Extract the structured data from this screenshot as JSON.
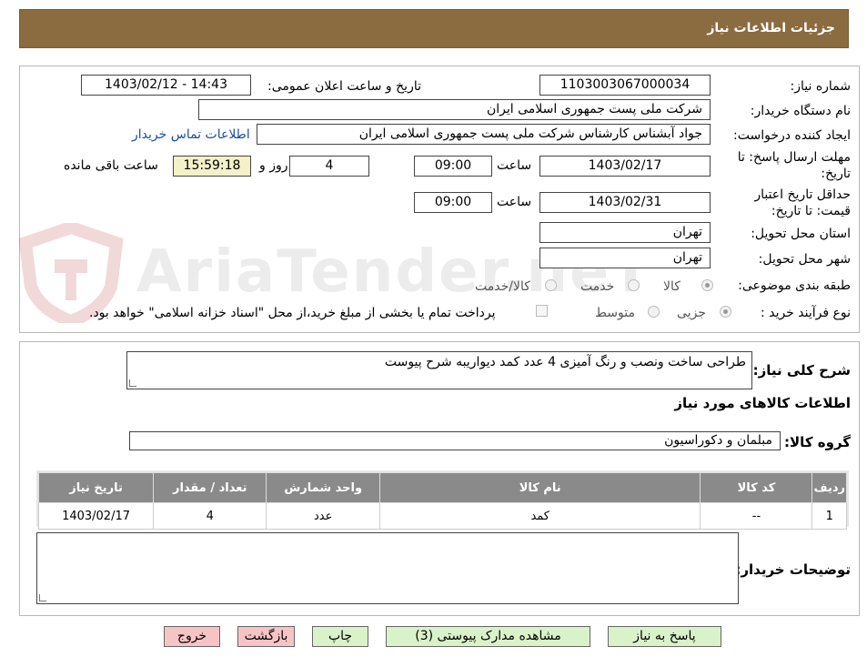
{
  "header": {
    "title": "جزئیات اطلاعات نیاز"
  },
  "watermark": {
    "text": "AriaTender.neT"
  },
  "form": {
    "need_number_label": "شماره نیاز:",
    "need_number": "1103003067000034",
    "announce_label": "تاریخ و ساعت اعلان عمومی:",
    "announce_value": "1403/02/12 - 14:43",
    "buyer_label": "نام دستگاه خریدار:",
    "buyer_value": "شرکت ملی پست جمهوری اسلامی ایران",
    "creator_label": "ایجاد کننده درخواست:",
    "creator_value": "جواد آبشناس کارشناس شرکت ملی پست جمهوری اسلامی ایران",
    "contact_link": "اطلاعات تماس خریدار",
    "deadline_label_1": "مهلت ارسال پاسخ: تا",
    "deadline_label_2": "تاریخ:",
    "deadline_date": "1403/02/17",
    "time_label": "ساعت",
    "deadline_time": "09:00",
    "days_value": "4",
    "days_label": "روز و",
    "remaining_time": "15:59:18",
    "remaining_label": "ساعت باقی مانده",
    "validity_label_1": "حداقل تاریخ اعتبار",
    "validity_label_2": "قیمت: تا تاریخ:",
    "validity_date": "1403/02/31",
    "validity_time": "09:00",
    "province_label": "استان محل تحویل:",
    "province_value": "تهران",
    "city_label": "شهر محل تحویل:",
    "city_value": "تهران",
    "category_label": "طبقه بندی موضوعی:",
    "category_options": [
      "کالا",
      "خدمت",
      "کالا/خدمت"
    ],
    "process_label": "نوع فرآیند خرید :",
    "process_options": [
      "جزیی",
      "متوسط"
    ],
    "payment_note": "پرداخت تمام یا بخشی از مبلغ خرید،از محل \"اسناد خزانه اسلامی\" خواهد بود."
  },
  "details": {
    "summary_label": "شرح کلی نیاز:",
    "summary_value": "طراحی ساخت ونصب و رنگ آمیزی 4 عدد کمد دیواریبه شرح پیوست",
    "goods_info_title": "اطلاعات کالاهای مورد نیاز",
    "group_label": "گروه کالا:",
    "group_value": "مبلمان و دکوراسیون",
    "table": {
      "headers": [
        "ردیف",
        "کد کالا",
        "نام کالا",
        "واحد شمارش",
        "تعداد / مقدار",
        "تاریخ نیاز"
      ],
      "rows": [
        [
          "1",
          "--",
          "کمد",
          "عدد",
          "4",
          "1403/02/17"
        ]
      ]
    },
    "buyer_notes_label": "توضیحات خریدار:",
    "buyer_notes_value": ""
  },
  "buttons": {
    "reply": "پاسخ به نیاز",
    "attachments": "مشاهده مدارک پیوستی (3)",
    "print": "چاپ",
    "back": "بازگشت",
    "exit": "خروج"
  }
}
